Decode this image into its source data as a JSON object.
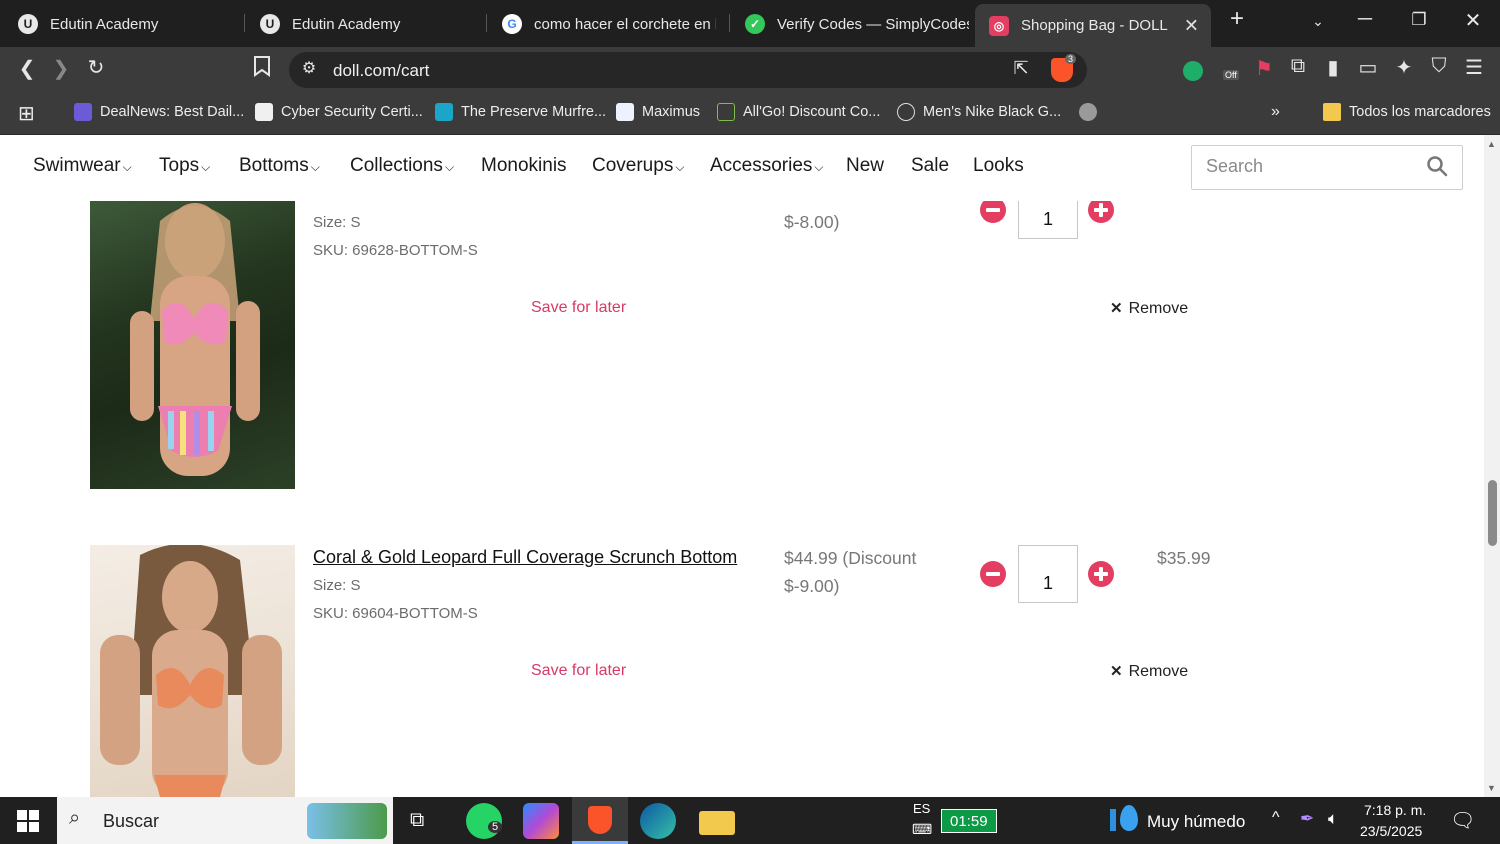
{
  "browser": {
    "tabs": [
      {
        "title": "Edutin Academy",
        "active": false
      },
      {
        "title": "Edutin Academy",
        "active": false
      },
      {
        "title": "como hacer el corchete en lap",
        "active": false
      },
      {
        "title": "Verify Codes — SimplyCodes",
        "active": false
      },
      {
        "title": "Shopping Bag - DOLL",
        "active": true
      }
    ],
    "url": "doll.com/cart",
    "brave_badge": "3",
    "extension_off": "Off",
    "bookmarks": [
      "DealNews: Best Dail...",
      "Cyber Security Certi...",
      "The Preserve Murfre...",
      "Maximus",
      "All'Go! Discount Co...",
      "Men's Nike Black G..."
    ],
    "overflow": "»",
    "all_bookmarks": "Todos los marcadores"
  },
  "site": {
    "nav": [
      {
        "label": "Swimwear",
        "dropdown": true
      },
      {
        "label": "Tops",
        "dropdown": true
      },
      {
        "label": "Bottoms",
        "dropdown": true
      },
      {
        "label": "Collections",
        "dropdown": true
      },
      {
        "label": "Monokinis",
        "dropdown": false
      },
      {
        "label": "Coverups",
        "dropdown": true
      },
      {
        "label": "Accessories",
        "dropdown": true
      },
      {
        "label": "New",
        "dropdown": false
      },
      {
        "label": "Sale",
        "dropdown": false
      },
      {
        "label": "Looks",
        "dropdown": false
      }
    ],
    "search_placeholder": "Search"
  },
  "cart": {
    "items": [
      {
        "size": "Size: S",
        "sku": "SKU: 69628-BOTTOM-S",
        "discount_line": "$-8.00)",
        "quantity": "1",
        "save_for_later": "Save for later",
        "remove": "Remove"
      },
      {
        "title": "Coral & Gold Leopard Full Coverage Scrunch Bottom",
        "size": "Size: S",
        "sku": "SKU: 69604-BOTTOM-S",
        "price_line1": "$44.99 (Discount",
        "price_line2": "$-9.00)",
        "quantity": "1",
        "line_total": "$35.99",
        "save_for_later": "Save for later",
        "remove": "Remove"
      }
    ]
  },
  "taskbar": {
    "search": "Buscar",
    "whatsapp_badge": "5",
    "lang": "ES",
    "battery_time": "01:59",
    "weather": "Muy húmedo",
    "time": "7:18 p. m.",
    "date": "23/5/2025"
  },
  "colors": {
    "accent": "#e33d62",
    "save_link": "#d63a66",
    "chrome_dark": "#1f1f1f",
    "chrome_mid": "#3b3b3b"
  }
}
